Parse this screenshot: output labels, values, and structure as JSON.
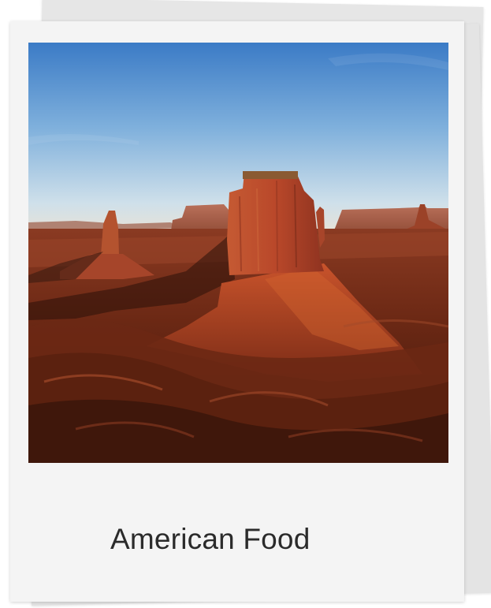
{
  "caption": "American Food",
  "photo": {
    "subject": "desert-butte-landscape"
  },
  "colors": {
    "card": "#f4f4f4",
    "stack": "#e6e6e6",
    "caption_text": "#2b2b2b",
    "sky_top": "#3f7fc9",
    "sky_horizon": "#dce8ef",
    "rock": "#b9482a"
  }
}
